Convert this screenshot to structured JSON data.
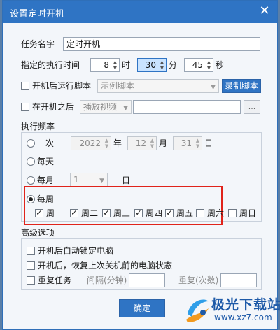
{
  "dialog": {
    "title": "设置定时开机"
  },
  "task": {
    "name_label": "任务名字",
    "name_value": "定时开机"
  },
  "exec_time": {
    "label": "指定的执行时间",
    "hour": "8",
    "hour_unit": "时",
    "minute": "30",
    "minute_unit": "分",
    "second": "45",
    "second_unit": "秒"
  },
  "run_script": {
    "label": "开机后运行脚本",
    "select": "示例脚本",
    "record_button": "录制脚本"
  },
  "after_boot": {
    "label": "在开机之后",
    "action": "播放视频",
    "path_value": "",
    "browse_button": "..."
  },
  "frequency": {
    "section_label": "执行频率",
    "once": {
      "label": "一次",
      "year": "2022",
      "year_unit": "年",
      "month": "12",
      "month_unit": "月",
      "day": "31",
      "day_unit": "日"
    },
    "daily": {
      "label": "每天"
    },
    "monthly": {
      "label": "每月",
      "day": "1",
      "day_unit": "日"
    },
    "weekly": {
      "label": "每周",
      "days": [
        {
          "label": "周一",
          "checked": true
        },
        {
          "label": "周二",
          "checked": true
        },
        {
          "label": "周三",
          "checked": true
        },
        {
          "label": "周四",
          "checked": true
        },
        {
          "label": "周五",
          "checked": true
        },
        {
          "label": "周六",
          "checked": false
        },
        {
          "label": "周日",
          "checked": false
        }
      ]
    },
    "selected": "weekly"
  },
  "advanced": {
    "section_label": "高级选项",
    "lock_pc": "开机后自动锁定电脑",
    "restore_state": "开机后，恢复上次关机前的电脑状态",
    "repeat_task": "重复任务",
    "interval_label": "间隔(分钟)",
    "repeat_count_label": "重复(次数)"
  },
  "confirm_button": "确定",
  "watermark": {
    "brand": "极光下载站",
    "site": "www.xz7.com"
  },
  "colors": {
    "accent": "#2f74c4",
    "highlight": "#e0231a",
    "brand": "#1e5aa8"
  }
}
